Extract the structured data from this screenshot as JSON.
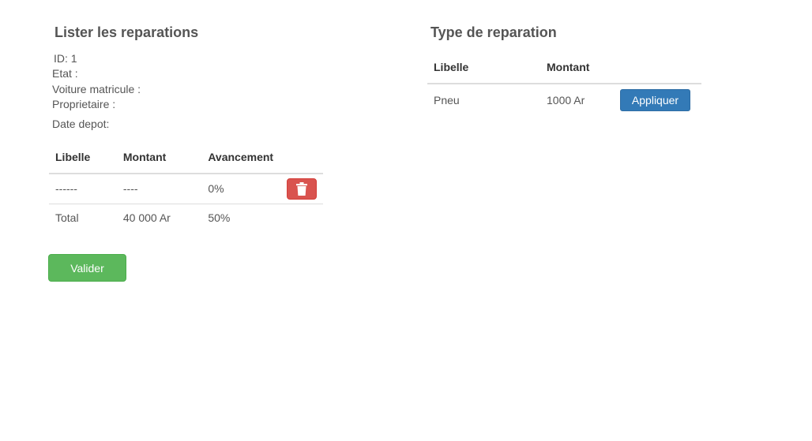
{
  "left": {
    "title": "Lister les reparations",
    "info": {
      "id": "ID: 1",
      "etat": "Etat :",
      "voiture": "Voiture matricule :",
      "proprietaire": "Proprietaire :",
      "date_depot": "Date depot:"
    },
    "table": {
      "headers": [
        "Libelle",
        "Montant",
        "Avancement"
      ],
      "rows": [
        {
          "libelle": "------",
          "montant": "----",
          "avancement": "0%"
        },
        {
          "libelle": "Total",
          "montant": "40 000 Ar",
          "avancement": "50%"
        }
      ]
    },
    "valider_label": "Valider",
    "delete_icon": "trash-icon"
  },
  "right": {
    "title": "Type de reparation",
    "table": {
      "headers": [
        "Libelle",
        "Montant"
      ],
      "rows": [
        {
          "libelle": "Pneu",
          "montant": "1000 Ar",
          "action": "Appliquer"
        }
      ]
    }
  },
  "colors": {
    "danger": "#d9534f",
    "primary": "#337ab7",
    "success": "#5cb85c"
  }
}
